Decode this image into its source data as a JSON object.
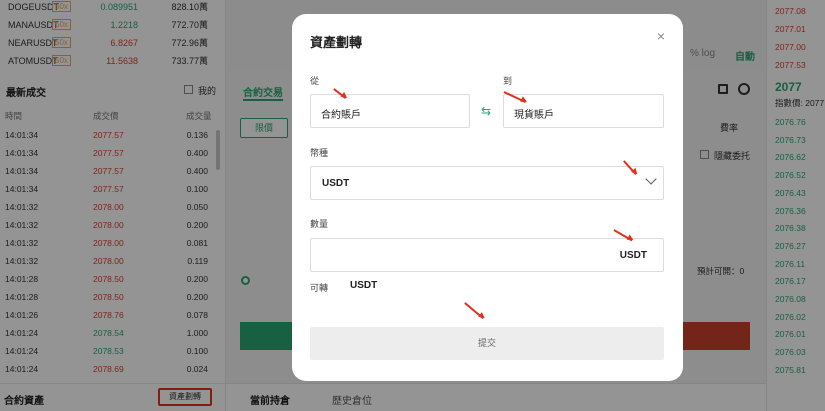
{
  "tickers": [
    {
      "symbol": "DOGEUSDT",
      "leverage": "50x",
      "price": "0.089951",
      "volume": "828.10萬",
      "price_color": "#2aa672"
    },
    {
      "symbol": "MANAUSDT",
      "leverage": "50x",
      "price": "1.2218",
      "volume": "772.70萬",
      "price_color": "#2aa672"
    },
    {
      "symbol": "NEARUSDT",
      "leverage": "50x",
      "price": "6.8267",
      "volume": "772.96萬",
      "price_color": "#d6432f"
    },
    {
      "symbol": "ATOMUSDT",
      "leverage": "50x",
      "price": "11.5638",
      "volume": "733.77萬",
      "price_color": "#d6432f"
    }
  ],
  "trades_panel": {
    "title": "最新成交",
    "mine_label": "我的",
    "headers": {
      "time": "時間",
      "price": "成交價",
      "qty": "成交量"
    },
    "rows": [
      {
        "time": "14:01:34",
        "price": "2077.57",
        "qty": "0.136",
        "color": "#d6432f"
      },
      {
        "time": "14:01:34",
        "price": "2077.57",
        "qty": "0.400",
        "color": "#d6432f"
      },
      {
        "time": "14:01:34",
        "price": "2077.57",
        "qty": "0.400",
        "color": "#d6432f"
      },
      {
        "time": "14:01:34",
        "price": "2077.57",
        "qty": "0.100",
        "color": "#d6432f"
      },
      {
        "time": "14:01:32",
        "price": "2078.00",
        "qty": "0.050",
        "color": "#d6432f"
      },
      {
        "time": "14:01:32",
        "price": "2078.00",
        "qty": "0.200",
        "color": "#d6432f"
      },
      {
        "time": "14:01:32",
        "price": "2078.00",
        "qty": "0.081",
        "color": "#d6432f"
      },
      {
        "time": "14:01:32",
        "price": "2078.00",
        "qty": "0.119",
        "color": "#d6432f"
      },
      {
        "time": "14:01:28",
        "price": "2078.50",
        "qty": "0.200",
        "color": "#d6432f"
      },
      {
        "time": "14:01:28",
        "price": "2078.50",
        "qty": "0.200",
        "color": "#d6432f"
      },
      {
        "time": "14:01:26",
        "price": "2078.76",
        "qty": "0.078",
        "color": "#d6432f"
      },
      {
        "time": "14:01:24",
        "price": "2078.54",
        "qty": "1.000",
        "color": "#2aa672"
      },
      {
        "time": "14:01:24",
        "price": "2078.53",
        "qty": "0.100",
        "color": "#2aa672"
      },
      {
        "time": "14:01:24",
        "price": "2078.69",
        "qty": "0.024",
        "color": "#d6432f"
      }
    ]
  },
  "assets": {
    "title": "合約資產",
    "transfer_link": "資產劃轉"
  },
  "trade_form": {
    "tab": "合約交易",
    "limit_button": "限價",
    "fee_label": "費率",
    "hide_label": "隱藏委托",
    "estimate_label": "預計可開：0"
  },
  "chart_controls": {
    "zoom_labels": "% log",
    "auto_label": "自動"
  },
  "bottom_tabs": {
    "positions": "當前持倉",
    "history": "歷史倉位"
  },
  "order_book": {
    "asks": [
      "2077.08",
      "2077.01",
      "2077.00",
      "2077.53"
    ],
    "last_price": "2077",
    "index_label": "指數價: 2077",
    "bids": [
      "2076.76",
      "2076.73",
      "2076.62",
      "2076.52",
      "2076.43",
      "2076.36",
      "2076.38",
      "2076.27",
      "2076.11",
      "2076.17",
      "2076.08",
      "2076.02",
      "2076.01",
      "2076.03",
      "2075.81"
    ]
  },
  "modal": {
    "title": "資產劃轉",
    "from_label": "從",
    "from_value": "合約賬戶",
    "to_label": "到",
    "to_value": "現貨賬戶",
    "coin_label": "幣種",
    "coin_value": "USDT",
    "amount_label": "數量",
    "amount_unit": "USDT",
    "available_label": "可轉",
    "available_unit": "USDT",
    "submit_label": "提交"
  },
  "colors": {
    "accent_green": "#2aa672",
    "sell_red": "#d6432f",
    "annotation_red": "#e0331d"
  }
}
